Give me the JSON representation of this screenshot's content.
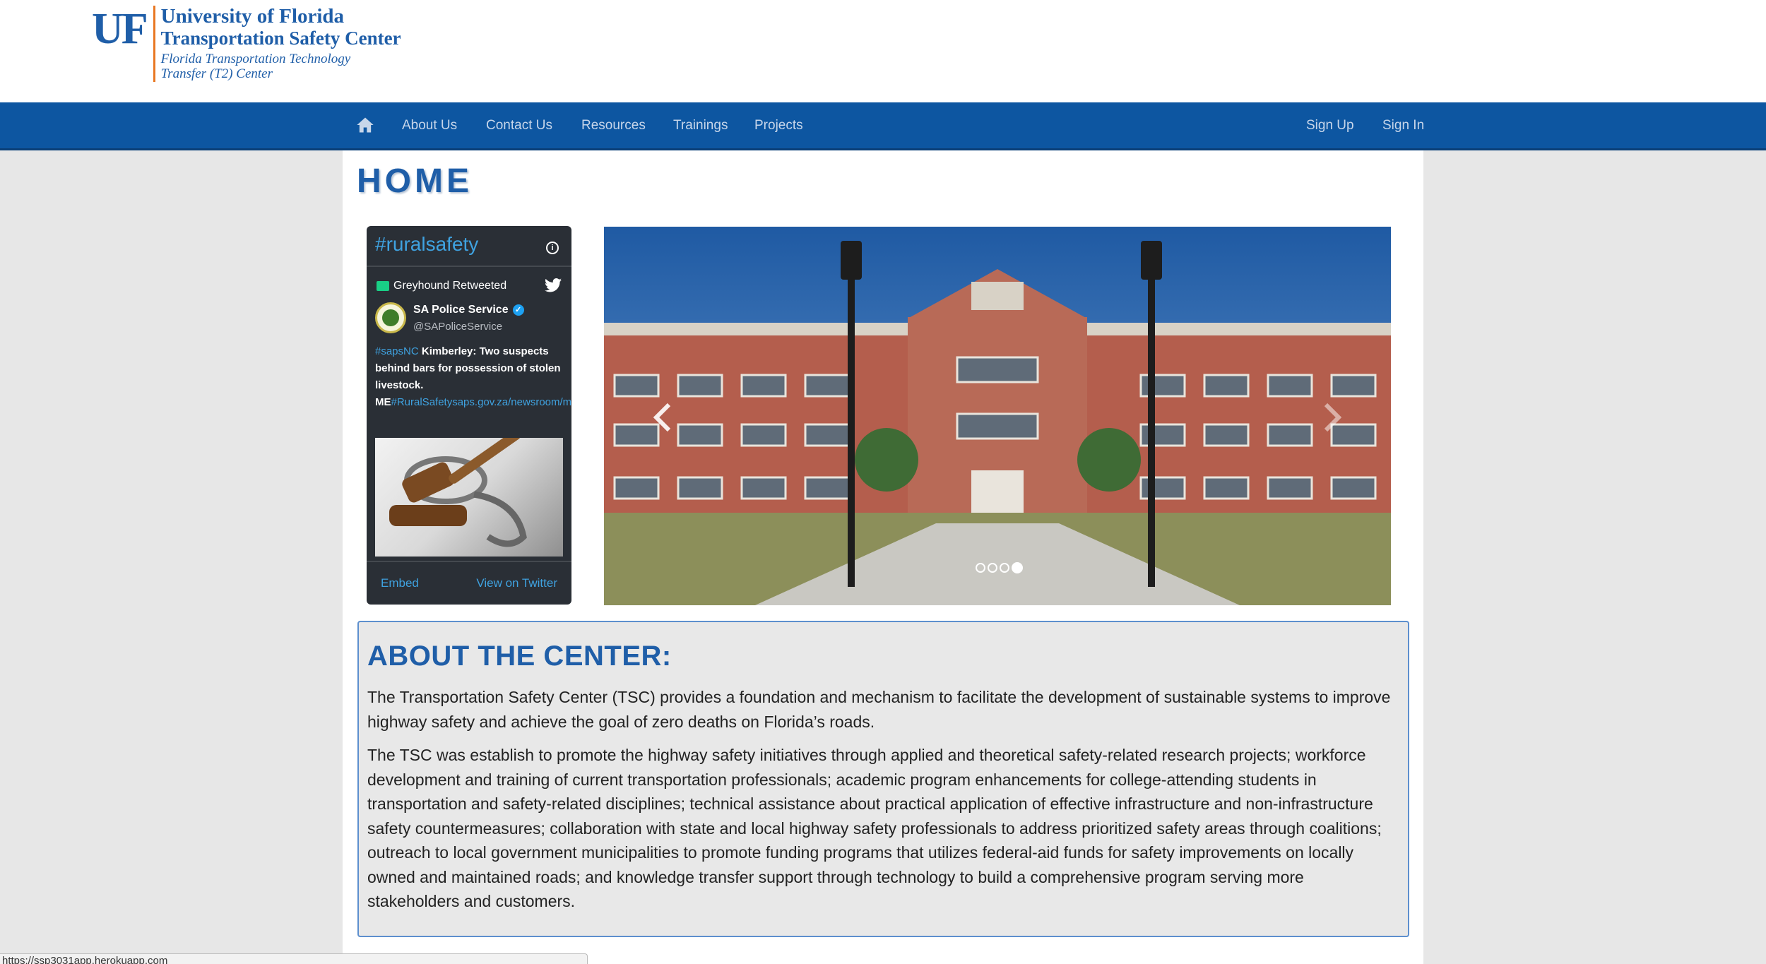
{
  "header": {
    "logo_mark": "UF",
    "logo_line1": "University of Florida",
    "logo_line2": "Transportation Safety Center",
    "logo_line3": "Florida Transportation Technology",
    "logo_line4": "Transfer (T2) Center"
  },
  "nav": {
    "home_icon": "home-icon",
    "items": [
      "About Us",
      "Contact Us",
      "Resources",
      "Trainings",
      "Projects"
    ],
    "right_items": [
      "Sign Up",
      "Sign In"
    ]
  },
  "page": {
    "title": "HOME"
  },
  "twitter_widget": {
    "hashtag": "#ruralsafety",
    "info_icon": "i",
    "retweet_label": "Greyhound Retweeted",
    "author_name": "SA Police Service",
    "author_handle": "@SAPoliceService",
    "tweet_hashtag": "#sapsNC",
    "tweet_text": " Kimberley: Two suspects behind bars for possession of stolen livestock. ME",
    "tweet_link": "#RuralSafetysaps.gov.za/newsroom/msspe…",
    "embed_label": "Embed",
    "view_label": "View on Twitter"
  },
  "carousel": {
    "slide_count": 4,
    "active_index": 3
  },
  "about": {
    "heading": "ABOUT THE CENTER:",
    "paragraph1": "The Transportation Safety Center (TSC) provides a foundation and mechanism to facilitate the development of sustainable systems to improve highway safety and achieve the goal of zero deaths on Florida’s roads.",
    "paragraph2": "The TSC was establish to promote the highway safety initiatives through applied and theoretical safety-related research projects; workforce development and training of current transportation professionals; academic program enhancements for college-attending students in transportation and safety-related disciplines; technical assistance about practical application of effective infrastructure and non-infrastructure safety countermeasures; collaboration with state and local highway safety professionals to address prioritized safety areas through coalitions; outreach to local government municipalities to promote funding programs that utilizes federal-aid funds for safety improvements on locally owned and maintained roads; and knowledge transfer support through technology to build a comprehensive program serving more stakeholders and customers."
  },
  "status_bar": {
    "url": "https://ssp3031app.herokuapp.com"
  },
  "colors": {
    "brand_blue": "#1f5ea8",
    "nav_blue": "#0d56a1",
    "accent_orange": "#e87722",
    "twitter_blue": "#3fa2e0"
  }
}
